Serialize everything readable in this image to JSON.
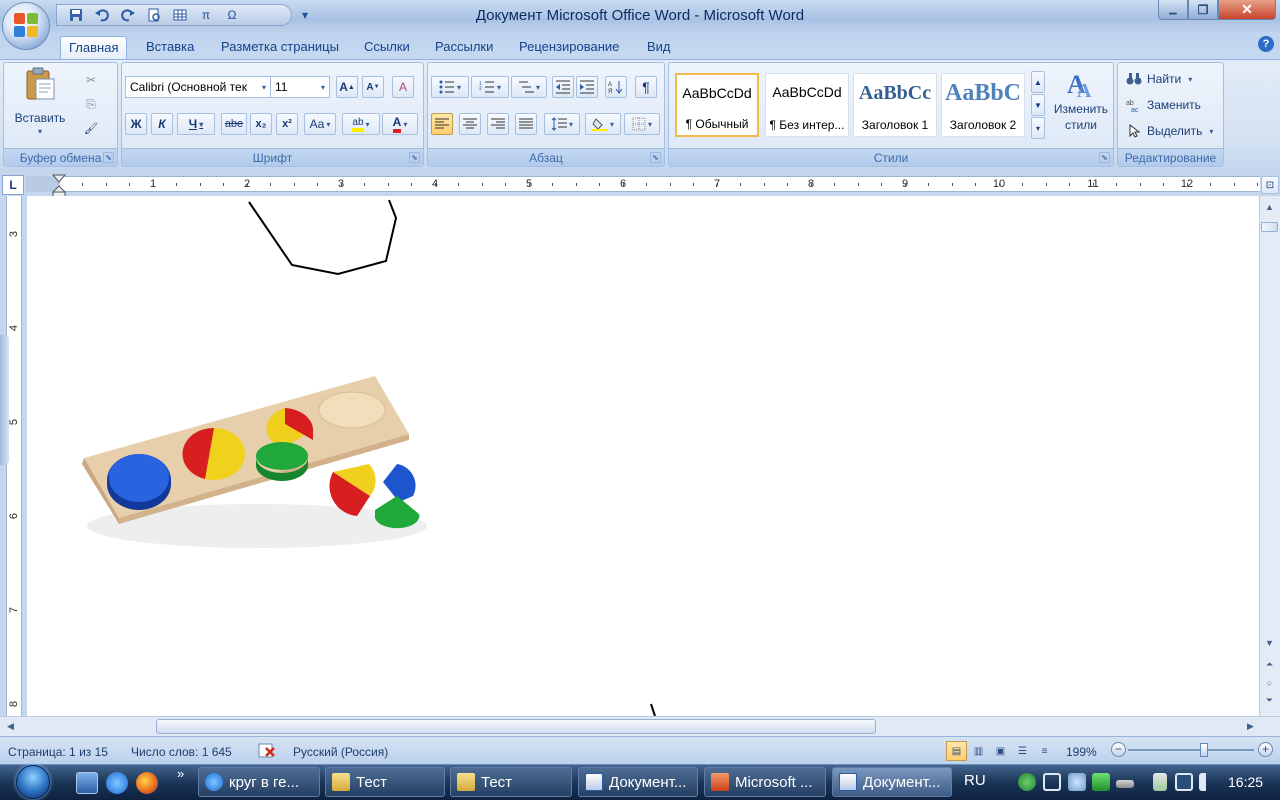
{
  "window": {
    "title": "Документ Microsoft Office Word - Microsoft Word",
    "controls": {
      "minimize": "▁",
      "maximize": "❐",
      "close": "✕"
    }
  },
  "qat": {
    "items": [
      "save-icon",
      "undo-icon",
      "redo-icon",
      "print-preview-icon",
      "table-icon",
      "equation-icon",
      "symbol-icon"
    ],
    "equation_label": "π",
    "symbol_label": "Ω",
    "customize": "▾"
  },
  "tabs": [
    "Главная",
    "Вставка",
    "Разметка страницы",
    "Ссылки",
    "Рассылки",
    "Рецензирование",
    "Вид"
  ],
  "active_tab": "Главная",
  "help": "?",
  "clipboard": {
    "paste_label": "Вставить",
    "group_label": "Буфер обмена",
    "cut_icon": "✂",
    "copy_icon": "⎘",
    "format_painter_icon": "🖌"
  },
  "font": {
    "family": "Calibri (Основной тек",
    "size": "11",
    "grow": "A",
    "shrink": "A",
    "clear": "A",
    "bold": "Ж",
    "italic": "К",
    "underline": "Ч",
    "strike": "abe",
    "subscript": "x₂",
    "superscript": "x²",
    "change_case": "Aa",
    "highlight": "ab",
    "font_color": "A",
    "group_label": "Шрифт"
  },
  "paragraph": {
    "group_label": "Абзац",
    "show_marks": "¶"
  },
  "styles": {
    "group_label": "Стили",
    "cards": [
      {
        "sample": "AaBbCcDd",
        "name": "¶ Обычный"
      },
      {
        "sample": "AaBbCcDd",
        "name": "¶ Без интер..."
      },
      {
        "sample": "AaBbCc",
        "name": "Заголовок 1"
      },
      {
        "sample": "AaBbC",
        "name": "Заголовок 2"
      }
    ],
    "change_styles": "Изменить стили"
  },
  "editing": {
    "group_label": "Редактирование",
    "find": "Найти",
    "replace": "Заменить",
    "select": "Выделить"
  },
  "ruler": {
    "tab_selector": "L",
    "numbers": [
      "1",
      "2",
      "3",
      "4",
      "5",
      "6",
      "7",
      "8",
      "9",
      "10",
      "11",
      "12"
    ],
    "vnumbers": [
      "3",
      "4",
      "5",
      "6",
      "7",
      "8"
    ]
  },
  "status": {
    "page": "Страница: 1 из 15",
    "words": "Число слов: 1 645",
    "language": "Русский (Россия)",
    "zoom": "199%",
    "zoom_out": "−",
    "zoom_in": "+"
  },
  "taskbar": {
    "tasks": [
      {
        "label": "круг в ге...",
        "icon": "ie-icon"
      },
      {
        "label": "Тест",
        "icon": "folder-icon"
      },
      {
        "label": "Тест",
        "icon": "folder-icon"
      },
      {
        "label": "Документ...",
        "icon": "word-icon"
      },
      {
        "label": "Microsoft ...",
        "icon": "powerpoint-icon"
      },
      {
        "label": "Документ...",
        "icon": "word-icon"
      }
    ],
    "chevron": "»",
    "lang": "RU",
    "time": "16:25"
  }
}
